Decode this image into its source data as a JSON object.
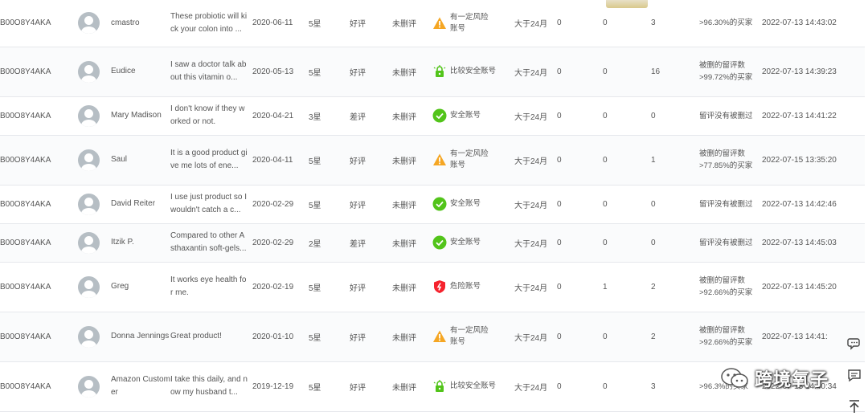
{
  "rows": [
    {
      "asin": "B00O8Y4AKA",
      "reviewer": "cmastro",
      "review": "These probiotic will kick your colon into ...",
      "date": "2020-06-11",
      "stars": "5星",
      "sentiment": "好评",
      "deleted": "未删评",
      "account": {
        "type": "warn",
        "label": "有一定风险账号",
        "color": "#f5a623"
      },
      "period": "大于24月",
      "v1": "0",
      "v2": "0",
      "v3": "3",
      "note": ">96.30%的买家",
      "time": "2022-07-13 14:43:02"
    },
    {
      "asin": "B00O8Y4AKA",
      "reviewer": "Eudice",
      "review": "I saw a doctor talk about this vitamin o...",
      "date": "2020-05-13",
      "stars": "5星",
      "sentiment": "好评",
      "deleted": "未删评",
      "account": {
        "type": "safe-ish",
        "label": "比较安全账号",
        "color": "#52c41a"
      },
      "period": "大于24月",
      "v1": "0",
      "v2": "0",
      "v3": "16",
      "note": "被删的留评数>99.72%的买家",
      "time": "2022-07-13 14:39:23"
    },
    {
      "asin": "B00O8Y4AKA",
      "reviewer": "Mary Madison",
      "review": "I don't know if they worked or not.",
      "date": "2020-04-21",
      "stars": "3星",
      "sentiment": "差评",
      "deleted": "未删评",
      "account": {
        "type": "safe",
        "label": "安全账号",
        "color": "#52c41a"
      },
      "period": "大于24月",
      "v1": "0",
      "v2": "0",
      "v3": "0",
      "note": "留评没有被删过",
      "time": "2022-07-13 14:41:22"
    },
    {
      "asin": "B00O8Y4AKA",
      "reviewer": "Saul",
      "review": "It is a good product give me lots of ene...",
      "date": "2020-04-11",
      "stars": "5星",
      "sentiment": "好评",
      "deleted": "未删评",
      "account": {
        "type": "warn",
        "label": "有一定风险账号",
        "color": "#f5a623"
      },
      "period": "大于24月",
      "v1": "0",
      "v2": "0",
      "v3": "1",
      "note": "被删的留评数>77.85%的买家",
      "time": "2022-07-15 13:35:20"
    },
    {
      "asin": "B00O8Y4AKA",
      "reviewer": "David Reiter",
      "review": "I use just product so I wouldn't catch a c...",
      "date": "2020-02-29",
      "stars": "5星",
      "sentiment": "好评",
      "deleted": "未删评",
      "account": {
        "type": "safe",
        "label": "安全账号",
        "color": "#52c41a"
      },
      "period": "大于24月",
      "v1": "0",
      "v2": "0",
      "v3": "0",
      "note": "留评没有被删过",
      "time": "2022-07-13 14:42:46"
    },
    {
      "asin": "B00O8Y4AKA",
      "reviewer": "Itzik P.",
      "review": "Compared to other Asthaxantin soft-gels...",
      "date": "2020-02-29",
      "stars": "2星",
      "sentiment": "差评",
      "deleted": "未删评",
      "account": {
        "type": "safe",
        "label": "安全账号",
        "color": "#52c41a"
      },
      "period": "大于24月",
      "v1": "0",
      "v2": "0",
      "v3": "0",
      "note": "留评没有被删过",
      "time": "2022-07-13 14:45:03"
    },
    {
      "asin": "B00O8Y4AKA",
      "reviewer": "Greg",
      "review": "It works eye health for me.",
      "date": "2020-02-19",
      "stars": "5星",
      "sentiment": "好评",
      "deleted": "未删评",
      "account": {
        "type": "danger",
        "label": "危险账号",
        "color": "#f5222d"
      },
      "period": "大于24月",
      "v1": "0",
      "v2": "1",
      "v3": "2",
      "note": "被删的留评数>92.66%的买家",
      "time": "2022-07-13 14:45:20"
    },
    {
      "asin": "B00O8Y4AKA",
      "reviewer": "Donna Jennings",
      "review": "Great product!",
      "date": "2020-01-10",
      "stars": "5星",
      "sentiment": "好评",
      "deleted": "未删评",
      "account": {
        "type": "warn",
        "label": "有一定风险账号",
        "color": "#f5a623"
      },
      "period": "大于24月",
      "v1": "0",
      "v2": "0",
      "v3": "2",
      "note": "被删的留评数>92.66%的买家",
      "time": "2022-07-13 14:41:"
    },
    {
      "asin": "B00O8Y4AKA",
      "reviewer": "Amazon Customer",
      "review": "I take this daily, and now my husband t...",
      "date": "2019-12-19",
      "stars": "5星",
      "sentiment": "好评",
      "deleted": "未删评",
      "account": {
        "type": "safe-ish",
        "label": "比较安全账号",
        "color": "#52c41a"
      },
      "period": "大于24月",
      "v1": "0",
      "v2": "0",
      "v3": "3",
      "note": ">96.3%的买家",
      "time": "2022-07-13 14:40:34"
    }
  ],
  "watermark": {
    "text": "跨境氧子",
    "icon": "wechat-icon"
  },
  "side_icons": [
    "chat-bubble-icon",
    "message-icon",
    "back-to-top-icon"
  ]
}
